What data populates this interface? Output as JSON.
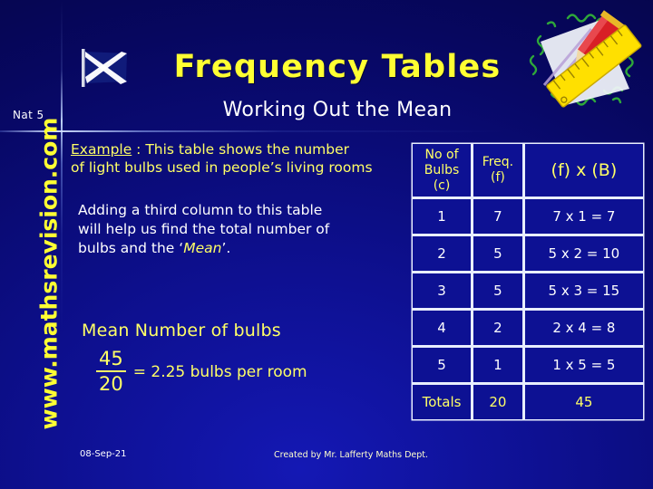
{
  "slide": {
    "nat_level": "Nat 5",
    "title": "Frequency Tables",
    "subtitle": "Working Out the Mean",
    "watermark": "www.mathsrevision.com"
  },
  "icons": {
    "flag": "scotland-saltire-flag-icon",
    "clipart": "pencil-and-ruler-icon"
  },
  "example": {
    "label": "Example",
    "separator": " : ",
    "line1_rest": "This table shows the number",
    "line2": "of light bulbs used in people’s living rooms"
  },
  "note": {
    "line1": "Adding a third column to this table",
    "line2": "will help us find the total number of",
    "line3_before": "bulbs and the ‘",
    "line3_highlight": "Mean",
    "line3_after": "’."
  },
  "mean": {
    "heading": "Mean Number of bulbs",
    "numerator": "45",
    "denominator": "20",
    "result": "= 2.25 bulbs per room"
  },
  "table": {
    "headers": {
      "col1_line1": "No of",
      "col1_line2": "Bulbs",
      "col1_line3": "(c)",
      "col2_line1": "Freq.",
      "col2_line2": "(f)",
      "col3": "(f) x (B)"
    },
    "rows": [
      {
        "bulbs": "1",
        "freq": "7",
        "product": "7 x 1 = 7"
      },
      {
        "bulbs": "2",
        "freq": "5",
        "product": "5 x 2 = 10"
      },
      {
        "bulbs": "3",
        "freq": "5",
        "product": "5 x 3 = 15"
      },
      {
        "bulbs": "4",
        "freq": "2",
        "product": "2 x 4 = 8"
      },
      {
        "bulbs": "5",
        "freq": "1",
        "product": "1 x 5 = 5"
      }
    ],
    "totals": {
      "label": "Totals",
      "freq": "20",
      "product": "45"
    }
  },
  "footer": {
    "date": "08-Sep-21",
    "credit": "Created by Mr. Lafferty Maths Dept."
  },
  "colors": {
    "background_dark": "#04043f",
    "background_mid": "#0d0f8c",
    "background_light": "#1418b4",
    "accent_yellow": "#ffff33",
    "text_yellow": "#ffff66",
    "text_white": "#ffffff",
    "table_cell": "#0d1193",
    "table_border": "#e8eeff"
  }
}
